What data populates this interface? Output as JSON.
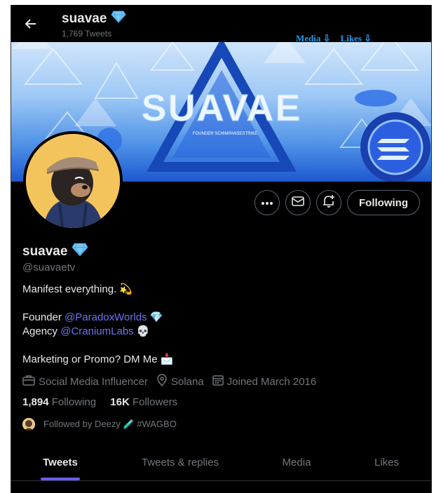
{
  "header": {
    "name": "suavae",
    "tweet_count": "1,769 Tweets",
    "links": [
      "Media ⇩",
      "Likes ⇩"
    ]
  },
  "profile": {
    "name": "suavae",
    "handle": "@suavaetv",
    "bio_line1": "Manifest everything.",
    "founder_label": "Founder",
    "founder_mention": "@ParadoxWorlds",
    "agency_label": "Agency",
    "agency_mention": "@CraniumLabs",
    "marketing": "Marketing or Promo? DM Me",
    "category": "Social Media Influencer",
    "location": "Solana",
    "joined": "Joined March 2016",
    "following_count": "1,894",
    "following_label": "Following",
    "followers_count": "16K",
    "followers_label": "Followers",
    "followed_by": "Followed by Deezy 🧪 #WAGBO"
  },
  "banner": {
    "title": "SUAVAE",
    "subtitle": "FOUNDER SCHIMPANSESTRIKE"
  },
  "buttons": {
    "follow_label": "Following"
  },
  "tabs": [
    "Tweets",
    "Tweets & replies",
    "Media",
    "Likes"
  ],
  "colors": {
    "background": "#000000",
    "accent_tab": "#6b5cf0",
    "mention": "#6b74f0",
    "muted": "#71767b",
    "avatar_bg": "#f4c45c"
  },
  "icons": [
    "back-arrow-icon",
    "verified-diamond-icon",
    "more-icon",
    "mail-icon",
    "notify-bell-icon",
    "briefcase-icon",
    "location-icon",
    "calendar-icon"
  ]
}
